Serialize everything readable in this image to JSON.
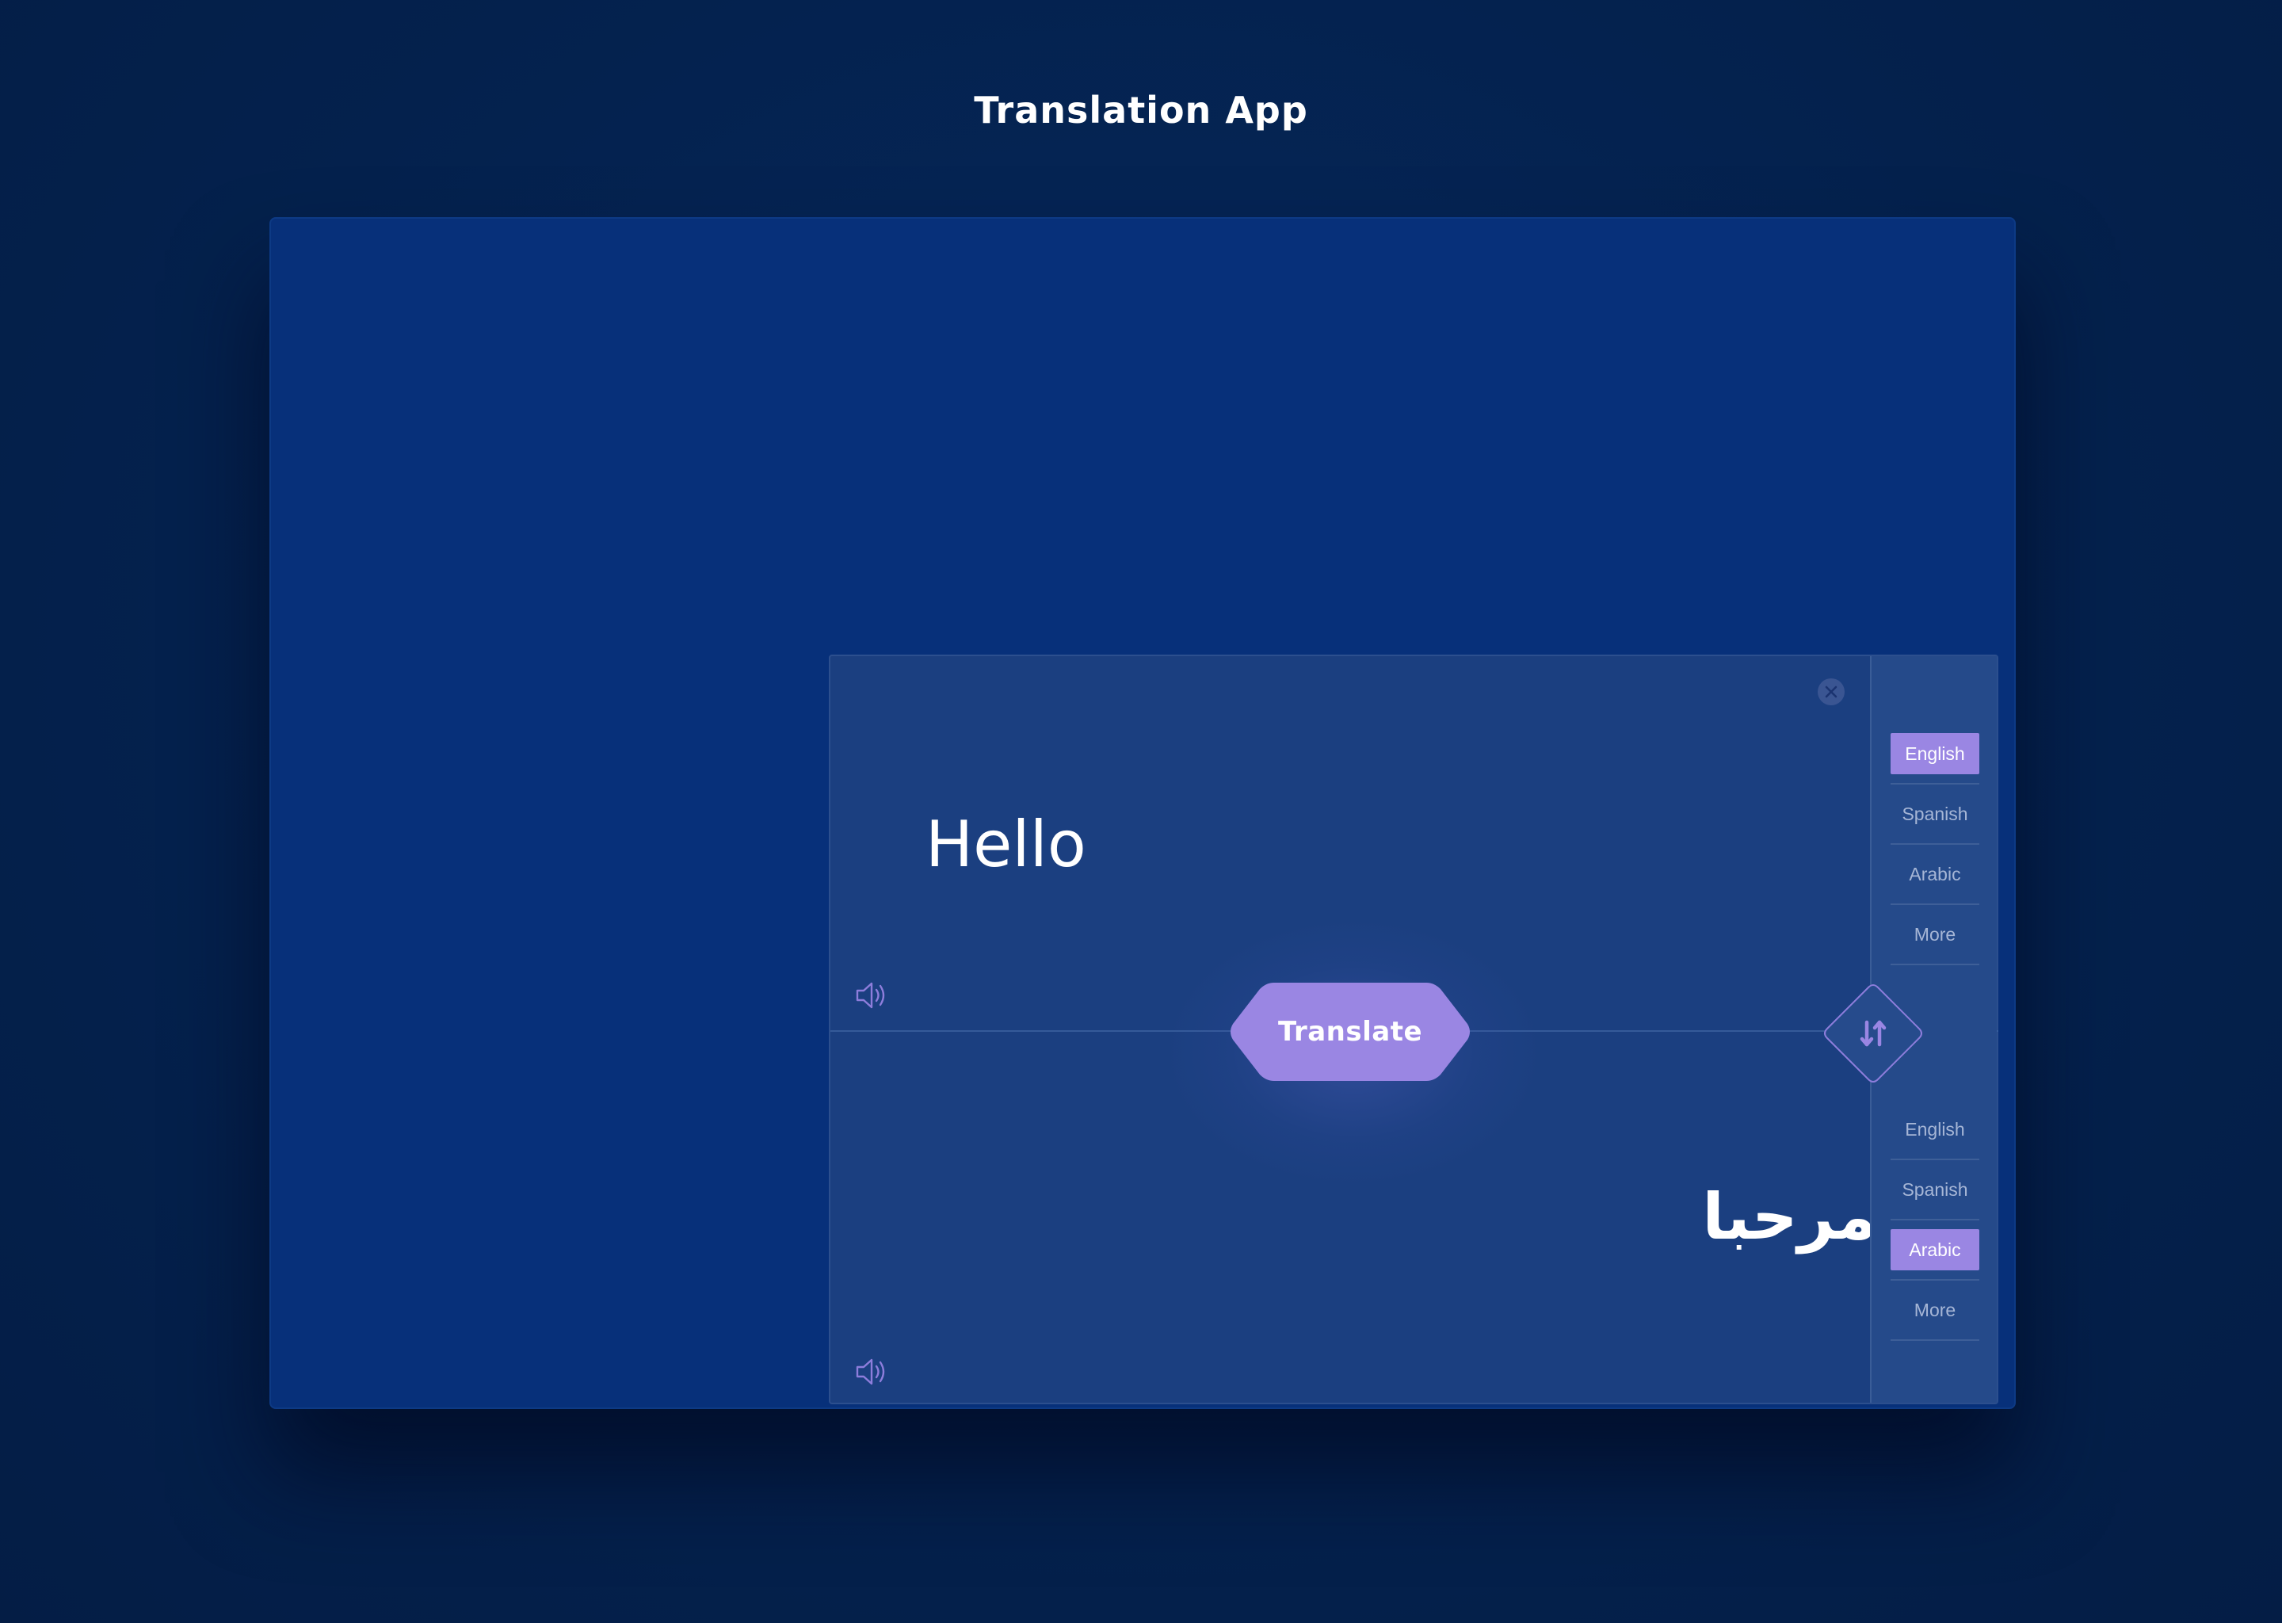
{
  "app": {
    "title": "Translation App"
  },
  "source": {
    "text": "Hello",
    "languages": [
      {
        "label": "English",
        "active": true
      },
      {
        "label": "Spanish",
        "active": false
      },
      {
        "label": "Arabic",
        "active": false
      },
      {
        "label": "More",
        "active": false
      }
    ]
  },
  "target": {
    "text": "مرحبا",
    "languages": [
      {
        "label": "English",
        "active": false
      },
      {
        "label": "Spanish",
        "active": false
      },
      {
        "label": "Arabic",
        "active": true
      },
      {
        "label": "More",
        "active": false
      }
    ]
  },
  "actions": {
    "translate_label": "Translate"
  },
  "icons": {
    "close": "close-icon",
    "speaker": "speaker-icon",
    "swap": "swap-vertical-icon"
  },
  "colors": {
    "accent": "#9a86e3",
    "background": "#04214d",
    "stage": "#07307a",
    "card": "#1b3f80",
    "sidebar": "#254a8a"
  }
}
